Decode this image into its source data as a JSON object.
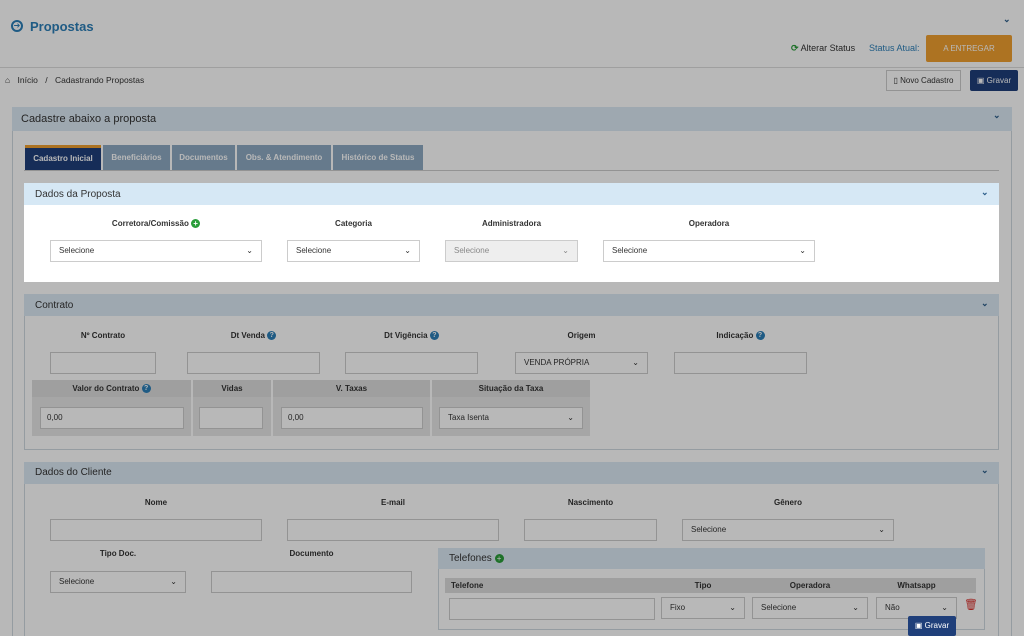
{
  "header": {
    "title": "Propostas",
    "alter_status": "Alterar Status",
    "status_label": "Status Atual:",
    "status_value": "A ENTREGAR"
  },
  "breadcrumb": {
    "home": "Início",
    "separator": "/",
    "current": "Cadastrando Propostas"
  },
  "toolbar": {
    "novo_label": "Novo Cadastro",
    "gravar_label": "Gravar"
  },
  "main": {
    "title": "Cadastre abaixo a proposta",
    "tabs": [
      {
        "label": "Cadastro Inicial"
      },
      {
        "label": "Beneficiários"
      },
      {
        "label": "Documentos"
      },
      {
        "label": "Obs. & Atendimento"
      },
      {
        "label": "Histórico de Status"
      }
    ]
  },
  "dados_proposta": {
    "title": "Dados da Proposta",
    "corretora_label": "Corretora/Comissão",
    "categoria_label": "Categoria",
    "administradora_label": "Administradora",
    "operadora_label": "Operadora",
    "corretora_value": "Selecione",
    "categoria_value": "Selecione",
    "administradora_value": "Selecione",
    "operadora_value": "Selecione"
  },
  "contrato": {
    "title": "Contrato",
    "n_contrato_label": "Nº Contrato",
    "dt_venda_label": "Dt Venda",
    "dt_vigencia_label": "Dt Vigência",
    "origem_label": "Origem",
    "origem_value": "VENDA PRÓPRIA",
    "indicacao_label": "Indicação",
    "valor_contrato_label": "Valor do Contrato",
    "valor_contrato_value": "0,00",
    "vidas_label": "Vidas",
    "v_taxas_label": "V. Taxas",
    "v_taxas_value": "0,00",
    "situacao_taxa_label": "Situação da Taxa",
    "situacao_taxa_value": "Taxa Isenta"
  },
  "cliente": {
    "title": "Dados do Cliente",
    "nome_label": "Nome",
    "email_label": "E-mail",
    "nascimento_label": "Nascimento",
    "genero_label": "Gênero",
    "genero_value": "Selecione",
    "tipo_doc_label": "Tipo Doc.",
    "tipo_doc_value": "Selecione",
    "documento_label": "Documento"
  },
  "telefones": {
    "title": "Telefones",
    "col_telefone": "Telefone",
    "col_tipo": "Tipo",
    "col_operadora": "Operadora",
    "col_whatsapp": "Whatsapp",
    "tipo_value": "Fixo",
    "operadora_value": "Selecione",
    "whatsapp_value": "Não"
  },
  "fab": {
    "gravar_label": "Gravar"
  },
  "colors": {
    "accent": "#2c7fb8",
    "primary_dark": "#1f3f7a",
    "status_orange": "#f0a030",
    "add_green": "#2a9d3a",
    "delete_red": "#d9302c"
  }
}
